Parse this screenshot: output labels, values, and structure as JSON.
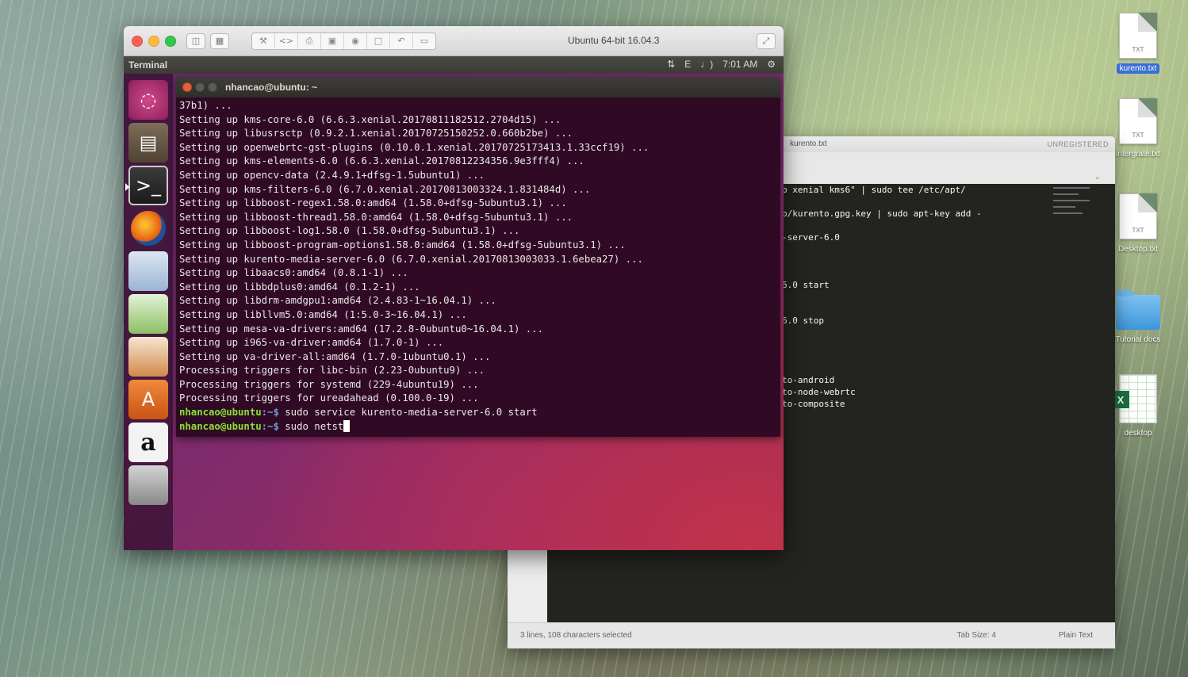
{
  "vm": {
    "window_title": "Ubuntu 64-bit 16.04.3",
    "toolbar_icons": [
      "wrench-icon",
      "chevron-icon",
      "printer-icon",
      "lock-icon",
      "camera-icon",
      "display-icon",
      "back-icon",
      "folder-icon"
    ]
  },
  "ubuntu_panel": {
    "app_name": "Terminal",
    "time": "7:01 AM",
    "indicators": [
      "sort-icon",
      "keyboard-icon",
      "volume-icon"
    ]
  },
  "launcher": {
    "items": [
      "dash-home",
      "files",
      "terminal",
      "firefox",
      "libreoffice-writer",
      "libreoffice-calc",
      "libreoffice-impress",
      "ubuntu-software",
      "amazon",
      "system-settings"
    ],
    "amazon_label": "a"
  },
  "terminal": {
    "title": "nhancao@ubuntu: ~",
    "lines": [
      "37b1) ...",
      "Setting up kms-core-6.0 (6.6.3.xenial.20170811182512.2704d15) ...",
      "Setting up libusrsctp (0.9.2.1.xenial.20170725150252.0.660b2be) ...",
      "Setting up openwebrtc-gst-plugins (0.10.0.1.xenial.20170725173413.1.33ccf19) ...",
      "Setting up kms-elements-6.0 (6.6.3.xenial.20170812234356.9e3fff4) ...",
      "Setting up opencv-data (2.4.9.1+dfsg-1.5ubuntu1) ...",
      "Setting up kms-filters-6.0 (6.7.0.xenial.20170813003324.1.831484d) ...",
      "Setting up libboost-regex1.58.0:amd64 (1.58.0+dfsg-5ubuntu3.1) ...",
      "Setting up libboost-thread1.58.0:amd64 (1.58.0+dfsg-5ubuntu3.1) ...",
      "Setting up libboost-log1.58.0 (1.58.0+dfsg-5ubuntu3.1) ...",
      "Setting up libboost-program-options1.58.0:amd64 (1.58.0+dfsg-5ubuntu3.1) ...",
      "Setting up kurento-media-server-6.0 (6.7.0.xenial.20170813003033.1.6ebea27) ...",
      "Setting up libaacs0:amd64 (0.8.1-1) ...",
      "Setting up libbdplus0:amd64 (0.1.2-1) ...",
      "Setting up libdrm-amdgpu1:amd64 (2.4.83-1~16.04.1) ...",
      "Setting up libllvm5.0:amd64 (1:5.0-3~16.04.1) ...",
      "Setting up mesa-va-drivers:amd64 (17.2.8-0ubuntu0~16.04.1) ...",
      "Setting up i965-va-driver:amd64 (1.7.0-1) ...",
      "Setting up va-driver-all:amd64 (1.7.0-1ubuntu0.1) ...",
      "Processing triggers for libc-bin (2.23-0ubuntu9) ...",
      "Processing triggers for systemd (229-4ubuntu19) ...",
      "Processing triggers for ureadahead (0.100.0-19) ..."
    ],
    "prompts": [
      {
        "user": "nhancao@ubuntu",
        "path": ":~$",
        "command": " sudo service kurento-media-server-6.0 start"
      },
      {
        "user": "nhancao@ubuntu",
        "path": ":~$",
        "command": " sudo netst"
      }
    ]
  },
  "desktop_icons": [
    {
      "label": "kurento.txt",
      "ext": "TXT",
      "kind": "document",
      "selected": true
    },
    {
      "label": "intergrate.txt",
      "ext": "TXT",
      "kind": "document",
      "selected": false
    },
    {
      "label": "Desktop.txt",
      "ext": "TXT",
      "kind": "document",
      "selected": false
    },
    {
      "label": "Tutorial docs",
      "ext": "",
      "kind": "folder",
      "selected": false
    },
    {
      "label": "desktop",
      "ext": "",
      "kind": "spreadsheet",
      "selected": false
    }
  ],
  "excel_badge": "X",
  "sublime": {
    "tab_title": "kurento.txt",
    "unregistered": "UNREGISTERED",
    "code_lines": [
      "p xenial kms6\" | sudo tee /etc/apt/",
      "",
      "p/kurento.gpg.key | sudo apt-key add -",
      "",
      "-server-6.0",
      "",
      "",
      "",
      "6.0 start",
      "",
      "",
      "6.0 stop",
      "",
      "",
      "",
      "",
      "to-android",
      "to-node-webrtc",
      "to-composite"
    ],
    "status_selection": "3 lines, 108 characters selected",
    "status_tab": "Tab Size: 4",
    "status_syntax": "Plain Text"
  }
}
